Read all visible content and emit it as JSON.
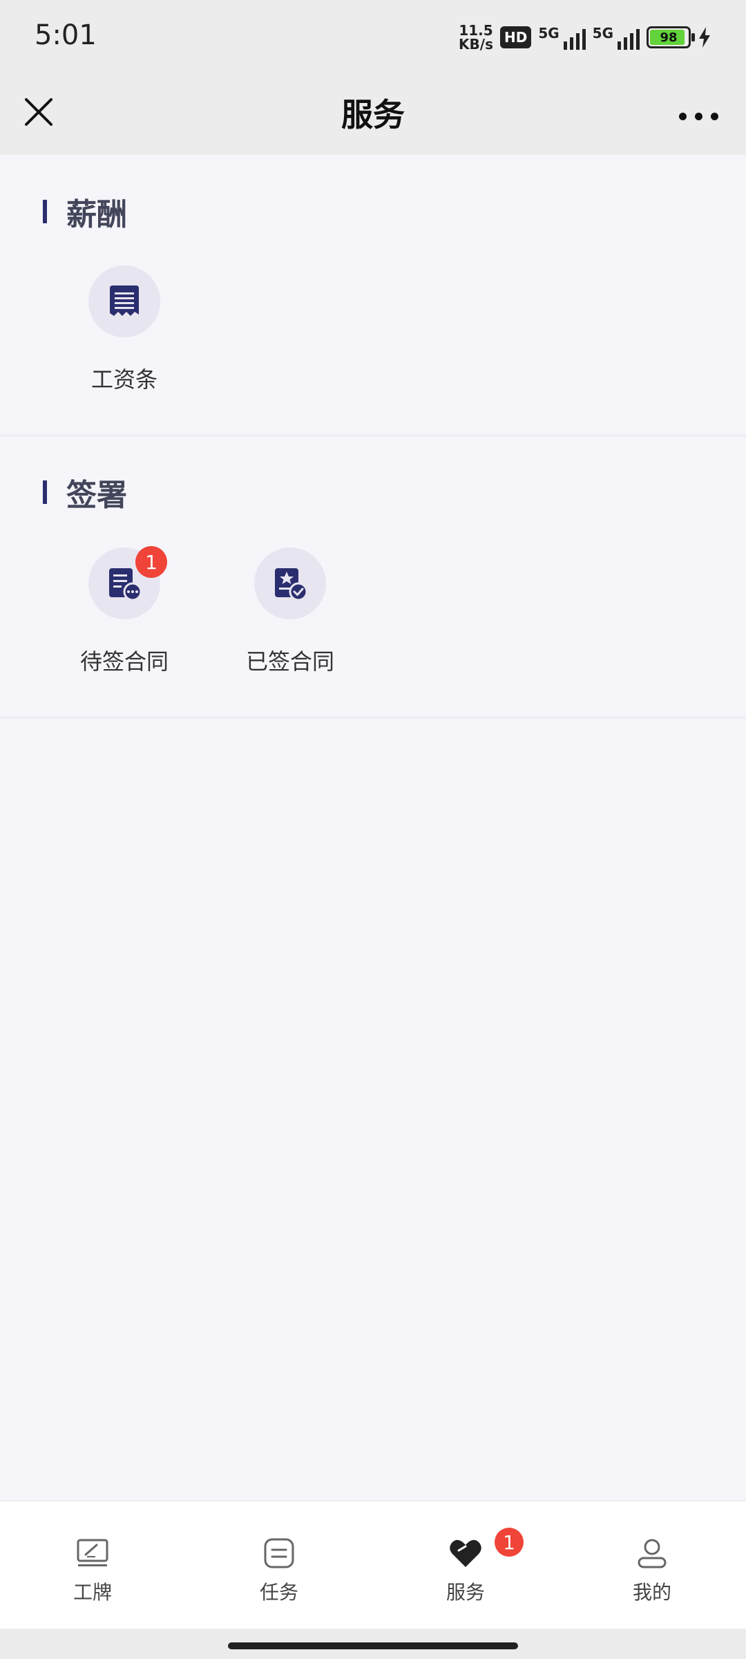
{
  "status_bar": {
    "time": "5:01",
    "net_speed_top": "11.5",
    "net_speed_bottom": "KB/s",
    "hd": "HD",
    "sim1": "5G",
    "sim2": "5G",
    "battery": "98"
  },
  "header": {
    "title": "服务",
    "close_icon": "close-icon",
    "more_icon": "more-icon"
  },
  "sections": [
    {
      "title": "薪酬",
      "items": [
        {
          "label": "工资条",
          "icon": "payslip-icon"
        }
      ]
    },
    {
      "title": "签署",
      "items": [
        {
          "label": "待签合同",
          "icon": "pending-contract-icon",
          "badge": "1"
        },
        {
          "label": "已签合同",
          "icon": "signed-contract-icon"
        }
      ]
    }
  ],
  "bottom_nav": [
    {
      "label": "工牌",
      "icon": "badge-card-icon"
    },
    {
      "label": "任务",
      "icon": "task-icon"
    },
    {
      "label": "服务",
      "icon": "heart-icon",
      "badge": "1",
      "active": true
    },
    {
      "label": "我的",
      "icon": "profile-icon"
    }
  ],
  "colors": {
    "accent": "#2b2e6e",
    "badge": "#f04438",
    "background": "#f6f5fa"
  }
}
